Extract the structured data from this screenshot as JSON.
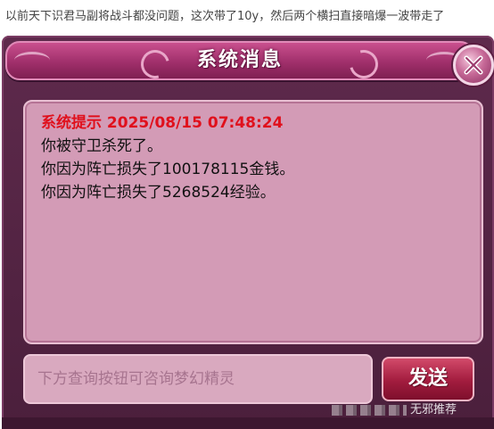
{
  "post": {
    "caption": "以前天下识君马副将战斗都没问题，这次带了10y，然后两个横扫直接暗爆一波带走了"
  },
  "dialog": {
    "title": "系统消息",
    "close_icon": "close-x-icon",
    "message": {
      "header": "系统提示 2025/08/15 07:48:24",
      "lines": [
        "你被守卫杀死了。",
        "你因为阵亡损失了100178115金钱。",
        "你因为阵亡损失了5268524经验。"
      ]
    },
    "input": {
      "placeholder": "下方查询按钮可咨询梦幻精灵"
    },
    "send_label": "发送"
  },
  "watermark": {
    "text": "无邪推荐"
  },
  "colors": {
    "frame": "#4b1f3c",
    "title_bar": "#a02f6b",
    "panel": "#d39bb6",
    "system_red": "#e0101c",
    "send_button": "#a21c3e"
  }
}
